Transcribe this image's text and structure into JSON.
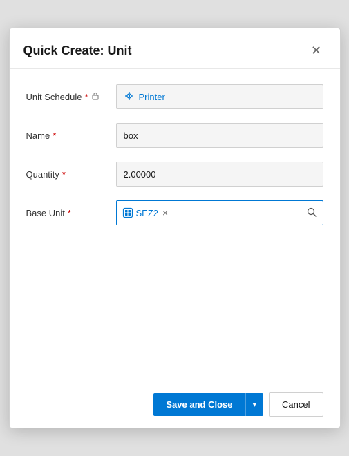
{
  "dialog": {
    "title": "Quick Create: Unit",
    "close_label": "×"
  },
  "form": {
    "unit_schedule": {
      "label": "Unit Schedule",
      "required": true,
      "locked": true,
      "value": "Printer",
      "icon": "unit-schedule-icon"
    },
    "name": {
      "label": "Name",
      "required": true,
      "value": "box",
      "placeholder": ""
    },
    "quantity": {
      "label": "Quantity",
      "required": true,
      "value": "2.00000",
      "placeholder": ""
    },
    "base_unit": {
      "label": "Base Unit",
      "required": true,
      "value": "SEZ2",
      "icon": "base-unit-icon"
    }
  },
  "footer": {
    "save_and_close_label": "Save and Close",
    "dropdown_arrow": "▾",
    "cancel_label": "Cancel"
  },
  "icons": {
    "close": "✕",
    "lock": "🔒",
    "unit_schedule_svg": "unit-schedule",
    "base_unit_svg": "base-unit",
    "search": "🔍",
    "remove": "×",
    "chevron_down": "▾"
  }
}
